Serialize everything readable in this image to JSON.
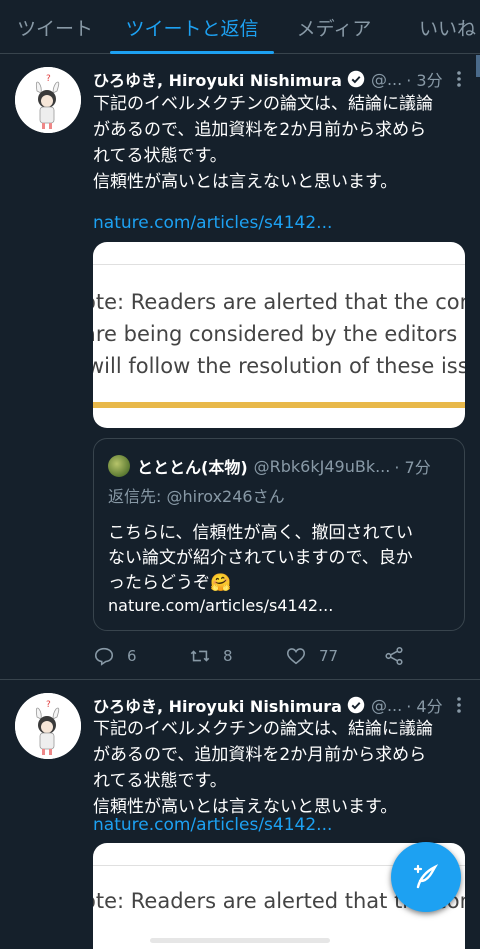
{
  "tabs": [
    {
      "label": "ツイート"
    },
    {
      "label": "ツイートと返信"
    },
    {
      "label": "メディア"
    },
    {
      "label": "いいね"
    }
  ],
  "tweets": [
    {
      "name": "ひろゆき, Hiroyuki Nishimura",
      "handle": "@...",
      "time": "· 3分",
      "text": "下記のイベルメクチンの論文は、結論に議論\nがあるので、追加資料を2か月前から求めら\nれてる状態です。\n信頼性が高いとは言えないと思います。",
      "link": "nature.com/articles/s4142...",
      "card_lines": [
        "ote: Readers are alerted that the conc",
        "are being considered by the editors a",
        " will follow the resolution of these iss"
      ],
      "quote": {
        "name": "とととん(本物)",
        "handle": "@Rbk6kJ49uBk...",
        "time": "· 7分",
        "reply_to": "返信先: @hirox246さん",
        "text": "こちらに、信頼性が高く、撤回されてい\nない論文が紹介されていますので、良か\nったらどうぞ🤗",
        "link": "nature.com/articles/s4142..."
      },
      "reply_count": "6",
      "retweet_count": "8",
      "like_count": "77"
    },
    {
      "name": "ひろゆき, Hiroyuki Nishimura",
      "handle": "@...",
      "time": "· 4分",
      "text": "下記のイベルメクチンの論文は、結論に議論\nがあるので、追加資料を2か月前から求めら\nれてる状態です。\n信頼性が高いとは言えないと思います。",
      "link": "nature.com/articles/s4142...",
      "card_lines": [
        "ote: Readers are alerted that the conc"
      ]
    }
  ],
  "colors": {
    "background": "#15202b",
    "accent": "#1da1f2",
    "muted": "#8899a6",
    "divider": "#38444d",
    "card_bar": "#e8b84a"
  },
  "icons": {
    "compose": "compose-tweet-icon",
    "verified": "verified-badge-icon",
    "reply": "reply-icon",
    "retweet": "retweet-icon",
    "like": "heart-icon",
    "share": "share-icon",
    "more": "more-vertical-icon"
  }
}
